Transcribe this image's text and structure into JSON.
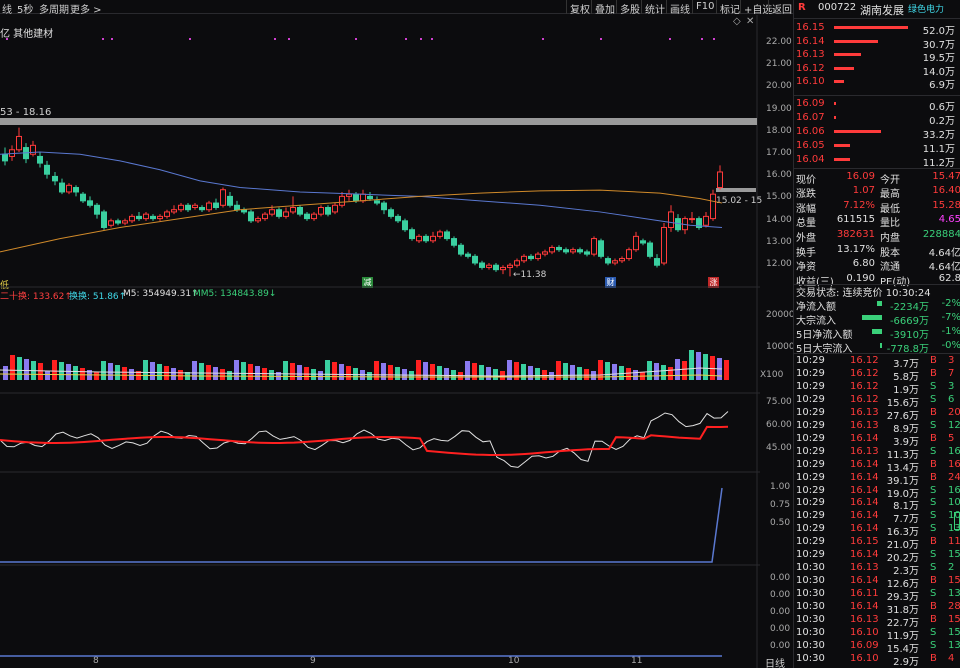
{
  "toolbar": {
    "left_items": [
      "线",
      "5秒",
      "多周期",
      "更多 >"
    ],
    "right_items": [
      "复权",
      "叠加",
      "多股",
      "统计",
      "画线",
      "F10",
      "标记",
      "+自选",
      "返回"
    ]
  },
  "chart": {
    "sector": "亿 其他建材",
    "range_label": "53 - 18.16",
    "price_axis": [
      "22.00",
      "21.00",
      "20.00",
      "19.00",
      "18.00",
      "17.00",
      "16.00",
      "15.00",
      "14.00",
      "13.00",
      "12.00"
    ],
    "low_annotation": "←11.38",
    "right_annotation": "15.02 - 15",
    "markers": {
      "m1": "减",
      "m2": "财",
      "m3": "涨",
      "m4": "低"
    },
    "indicator_line": {
      "a": "二十换: 133.62↑",
      "b": "换换: 51.86↑",
      "c": "M5: 354949.31↑",
      "d": "MM5: 134843.89↓"
    },
    "vol_axis": [
      "20000",
      "10000"
    ],
    "vol_unit": "X100",
    "osc_axis": [
      "75.00",
      "60.00",
      "45.00"
    ],
    "ind2_axis": [
      "1.00",
      "0.75",
      "0.50"
    ],
    "ind3_axis": [
      "0.00",
      "0.00",
      "0.00",
      "0.00",
      "0.00",
      "0.00"
    ],
    "x_labels": [
      "8",
      "9",
      "10",
      "11"
    ],
    "period_label": "日线"
  },
  "quote": {
    "header": {
      "flag": "R",
      "code": "000722",
      "name": "湖南发展",
      "tag": "绿色电力"
    },
    "asks": [
      {
        "price": "16.15",
        "vol": "52.0万",
        "frac": 1.0
      },
      {
        "price": "16.14",
        "vol": "30.7万",
        "frac": 0.59
      },
      {
        "price": "16.13",
        "vol": "19.5万",
        "frac": 0.37
      },
      {
        "price": "16.12",
        "vol": "14.0万",
        "frac": 0.27
      },
      {
        "price": "16.10",
        "vol": "6.9万",
        "frac": 0.13
      }
    ],
    "bids": [
      {
        "price": "16.09",
        "vol": "0.6万",
        "frac": 0.02
      },
      {
        "price": "16.07",
        "vol": "0.2万",
        "frac": 0.01
      },
      {
        "price": "16.06",
        "vol": "33.2万",
        "frac": 0.64
      },
      {
        "price": "16.05",
        "vol": "11.1万",
        "frac": 0.21
      },
      {
        "price": "16.04",
        "vol": "11.2万",
        "frac": 0.21
      }
    ],
    "stats": [
      {
        "l1": "现价",
        "v1": "16.09",
        "c1": "red",
        "l2": "今开",
        "v2": "15.47",
        "c2": "red"
      },
      {
        "l1": "涨跌",
        "v1": "1.07",
        "c1": "red",
        "l2": "最高",
        "v2": "16.40",
        "c2": "red"
      },
      {
        "l1": "涨幅",
        "v1": "7.12%",
        "c1": "red",
        "l2": "最低",
        "v2": "15.28",
        "c2": "red"
      },
      {
        "l1": "总量",
        "v1": "611515",
        "c1": "white",
        "l2": "量比",
        "v2": "4.65",
        "c2": "magenta"
      },
      {
        "l1": "外盘",
        "v1": "382631",
        "c1": "red",
        "l2": "内盘",
        "v2": "228884",
        "c2": "green"
      },
      {
        "l1": "换手",
        "v1": "13.17%",
        "c1": "white",
        "l2": "股本",
        "v2": "4.64亿",
        "c2": "white"
      },
      {
        "l1": "净资",
        "v1": "6.80",
        "c1": "white",
        "l2": "流通",
        "v2": "4.64亿",
        "c2": "white"
      },
      {
        "l1": "收益(三)",
        "v1": "0.190",
        "c1": "white",
        "l2": "PE(动)",
        "v2": "62.8",
        "c2": "white"
      }
    ],
    "trade_state": "交易状态: 连续竞价 10:30:24",
    "flows": [
      {
        "label": "净流入额",
        "value": "-2234万",
        "pct": "-2%",
        "frac": 0.25
      },
      {
        "label": "大宗流入",
        "value": "-6669万",
        "pct": "-7%",
        "frac": 1.0
      },
      {
        "label": "5日净流入额",
        "value": "-3910万",
        "pct": "-1%",
        "frac": 0.5
      },
      {
        "label": "5日大宗流入",
        "value": "-778.8万",
        "pct": "-0%",
        "frac": 0.08
      }
    ],
    "ticks": [
      {
        "t": "10:29",
        "p": "16.12",
        "v": "3.7万",
        "s": "B",
        "n": "3"
      },
      {
        "t": "10:29",
        "p": "16.12",
        "v": "5.8万",
        "s": "B",
        "n": "7"
      },
      {
        "t": "10:29",
        "p": "16.12",
        "v": "1.9万",
        "s": "S",
        "n": "3"
      },
      {
        "t": "10:29",
        "p": "16.12",
        "v": "15.6万",
        "s": "S",
        "n": "6"
      },
      {
        "t": "10:29",
        "p": "16.13",
        "v": "27.6万",
        "s": "B",
        "n": "20"
      },
      {
        "t": "10:29",
        "p": "16.13",
        "v": "8.9万",
        "s": "S",
        "n": "12"
      },
      {
        "t": "10:29",
        "p": "16.14",
        "v": "3.9万",
        "s": "B",
        "n": "5"
      },
      {
        "t": "10:29",
        "p": "16.13",
        "v": "11.3万",
        "s": "S",
        "n": "16"
      },
      {
        "t": "10:29",
        "p": "16.14",
        "v": "13.4万",
        "s": "B",
        "n": "16"
      },
      {
        "t": "10:29",
        "p": "16.14",
        "v": "39.1万",
        "s": "B",
        "n": "24"
      },
      {
        "t": "10:29",
        "p": "16.14",
        "v": "19.0万",
        "s": "S",
        "n": "16"
      },
      {
        "t": "10:29",
        "p": "16.14",
        "v": "8.1万",
        "s": "S",
        "n": "10"
      },
      {
        "t": "10:29",
        "p": "16.14",
        "v": "7.7万",
        "s": "S",
        "n": "10"
      },
      {
        "t": "10:29",
        "p": "16.14",
        "v": "16.3万",
        "s": "S",
        "n": "13"
      },
      {
        "t": "10:29",
        "p": "16.15",
        "v": "21.0万",
        "s": "B",
        "n": "11"
      },
      {
        "t": "10:29",
        "p": "16.14",
        "v": "20.2万",
        "s": "S",
        "n": "15"
      },
      {
        "t": "10:30",
        "p": "16.13",
        "v": "2.3万",
        "s": "S",
        "n": "2"
      },
      {
        "t": "10:30",
        "p": "16.14",
        "v": "12.6万",
        "s": "B",
        "n": "15"
      },
      {
        "t": "10:30",
        "p": "16.11",
        "v": "29.3万",
        "s": "S",
        "n": "13"
      },
      {
        "t": "10:30",
        "p": "16.14",
        "v": "31.8万",
        "s": "B",
        "n": "28"
      },
      {
        "t": "10:30",
        "p": "16.13",
        "v": "22.7万",
        "s": "B",
        "n": "15"
      },
      {
        "t": "10:30",
        "p": "16.10",
        "v": "11.9万",
        "s": "S",
        "n": "15"
      },
      {
        "t": "10:30",
        "p": "16.09",
        "v": "15.4万",
        "s": "S",
        "n": "13"
      },
      {
        "t": "10:30",
        "p": "16.10",
        "v": "2.9万",
        "s": "B",
        "n": "4"
      }
    ]
  }
}
